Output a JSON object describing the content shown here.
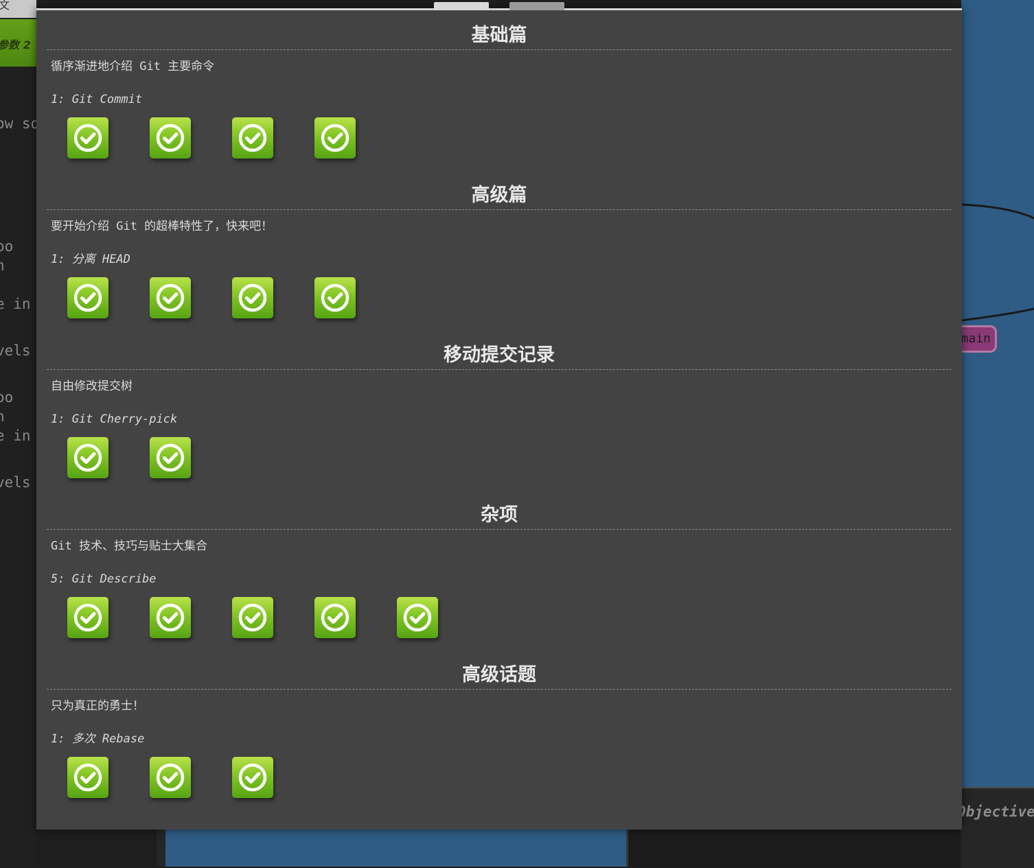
{
  "background": {
    "left_top_char": "文",
    "left_green_label": "参数 2",
    "left_code_lines": [
      "ow so",
      "oo",
      "n",
      "e in",
      "vels",
      "oo",
      "n",
      "e in",
      "vels"
    ],
    "branch_badge": "main",
    "right_bottom_label": "Objective"
  },
  "modal": {
    "tabs": [
      "",
      ""
    ],
    "sections": [
      {
        "title": "基础篇",
        "description": "循序渐进地介绍 Git 主要命令",
        "level": "1: Git Commit",
        "completed_levels": 4
      },
      {
        "title": "高级篇",
        "description": "要开始介绍 Git 的超棒特性了，快来吧！",
        "level": "1: 分离 HEAD",
        "completed_levels": 4
      },
      {
        "title": "移动提交记录",
        "description": "自由修改提交树",
        "level": "1: Git Cherry-pick",
        "completed_levels": 2
      },
      {
        "title": "杂项",
        "description": "Git 技术、技巧与贴士大集合",
        "level": "5: Git Describe",
        "completed_levels": 5
      },
      {
        "title": "高级话题",
        "description": "只为真正的勇士！",
        "level": "1: 多次 Rebase",
        "completed_levels": 3
      }
    ],
    "level_button_icon": "check-circle-icon",
    "level_button_color": "#7cc221"
  }
}
